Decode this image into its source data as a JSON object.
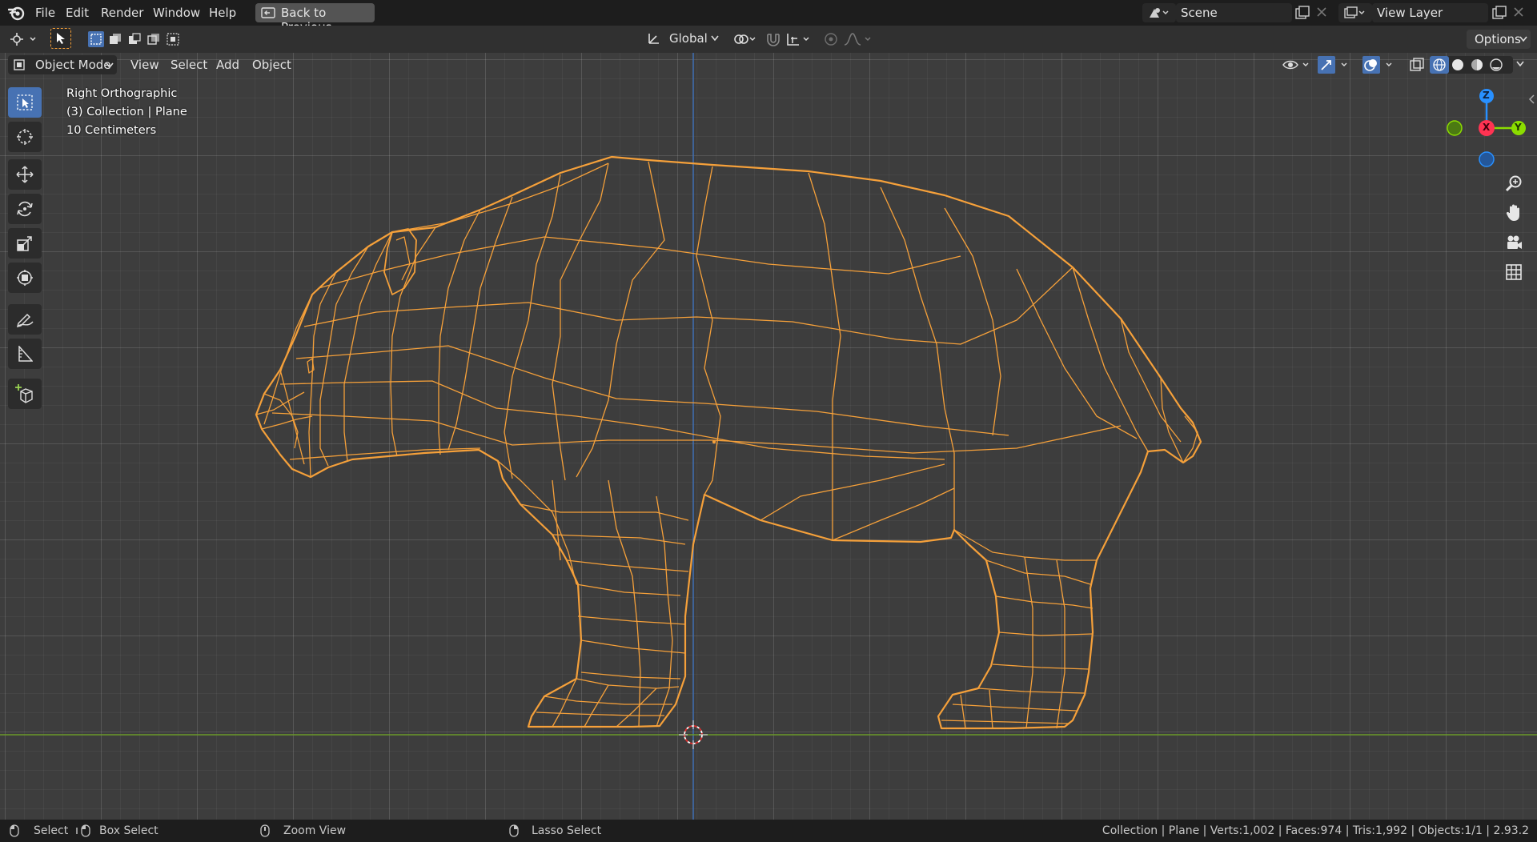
{
  "menu": {
    "items": [
      "File",
      "Edit",
      "Render",
      "Window",
      "Help"
    ],
    "back_button": "Back to Previous"
  },
  "scene": {
    "name": "Scene",
    "view_layer": "View Layer"
  },
  "tool_header": {
    "orientation": "Global",
    "options_label": "Options"
  },
  "viewport_header": {
    "mode": "Object Mode",
    "menus": [
      "View",
      "Select",
      "Add",
      "Object"
    ]
  },
  "overlay": {
    "view_name": "Right Orthographic",
    "collection_info": "(3) Collection | Plane",
    "scale_info": "10 Centimeters"
  },
  "gizmo": {
    "z_label": "Z",
    "x_label": "X",
    "y_label": "Y"
  },
  "tools": [
    "select-box-tool",
    "cursor-tool",
    "move-tool",
    "rotate-tool",
    "scale-tool",
    "transform-tool",
    "annotate-tool",
    "measure-tool",
    "add-cube-tool"
  ],
  "status": {
    "select": "Select",
    "box_select": "Box Select",
    "zoom_view": "Zoom View",
    "lasso_select": "Lasso Select",
    "stats": "Collection | Plane | Verts:1,002 | Faces:974 | Tris:1,992 | Objects:1/1 | 2.93.2"
  },
  "colors": {
    "wire": "#f5a03a",
    "active_tool": "#4772b3",
    "axis_x": "#ff3352",
    "axis_y": "#8bdc00",
    "axis_z": "#2890ff"
  }
}
